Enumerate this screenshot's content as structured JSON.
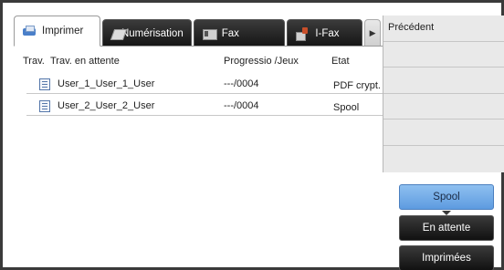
{
  "tabs": [
    {
      "label": "Imprimer",
      "icon": "printer-icon",
      "active": true
    },
    {
      "label": "Numérisation",
      "icon": "scan-icon"
    },
    {
      "label": "Fax",
      "icon": "fax-icon"
    },
    {
      "label": "I-Fax",
      "icon": "ifax-icon"
    }
  ],
  "tab_more_icon": "tab-scroll-right-icon",
  "table": {
    "headers": {
      "trav": "Trav.",
      "pending": "Trav. en attente",
      "progress": "Progressio /Jeux",
      "status": "Etat"
    },
    "rows": [
      {
        "name": "User_1_User_1_User",
        "progress": "---/0004",
        "status": "PDF crypt."
      },
      {
        "name": "User_2_User_2_User",
        "progress": "---/0004",
        "status": "Spool"
      }
    ]
  },
  "side": {
    "previous_label": "Précédent"
  },
  "filters": [
    {
      "label": "Spool",
      "selected": true
    },
    {
      "label": "En attente"
    },
    {
      "label": "Imprimées"
    }
  ],
  "colors": {
    "selected_filter": "#6aa6e6",
    "tab_dark": "#1f1f1f",
    "side_panel": "#e9e9e9"
  }
}
